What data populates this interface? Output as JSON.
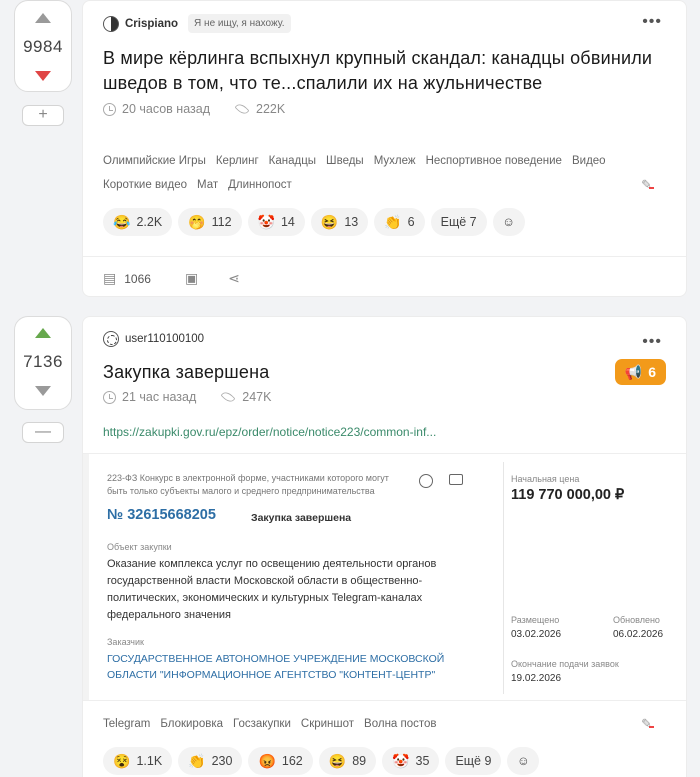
{
  "post1": {
    "rating": "9984",
    "author": "Crispiano",
    "status": "Я не ищу, я нахожу.",
    "title": "В мире кёрлинга вспыхнул крупный скандал: канадцы обвинили шведов в том, что те...спалили их на жульничестве",
    "time": "20 часов назад",
    "views": "222K",
    "tags": [
      "Олимпийские Игры",
      "Керлинг",
      "Канадцы",
      "Шведы",
      "Мухлеж",
      "Неспортивное поведение",
      "Видео",
      "Короткие видео",
      "Мат",
      "Длиннопост"
    ],
    "reactions": [
      {
        "emoji": "😂",
        "count": "2.2K"
      },
      {
        "emoji": "🤭",
        "count": "112"
      },
      {
        "emoji": "🤡",
        "count": "14"
      },
      {
        "emoji": "😆",
        "count": "13"
      },
      {
        "emoji": "👏",
        "count": "6"
      }
    ],
    "more_reactions": "Ещё 7",
    "comments": "1066",
    "rate_button": "+"
  },
  "post2": {
    "rating": "7136",
    "author": "user110100100",
    "title": "Закупка завершена",
    "badge": "6",
    "time": "21 час назад",
    "views": "247K",
    "link": "https://zakupki.gov.ru/epz/order/notice/notice223/common-inf...",
    "embed": {
      "law": "223-ФЗ Конкурс в электронной форме, участниками которого могут быть только субъекты малого и среднего предпринимательства",
      "number": "№ 32615668205",
      "status": "Закупка завершена",
      "object_label": "Объект закупки",
      "object_text": "Оказание комплекса услуг по освещению деятельности органов государственной власти Московской области в общественно-политических, экономических и культурных Telegram-каналах федерального значения",
      "customer_label": "Заказчик",
      "customer": "ГОСУДАРСТВЕННОЕ АВТОНОМНОЕ УЧРЕЖДЕНИЕ МОСКОВСКОЙ ОБЛАСТИ \"ИНФОРМАЦИОННОЕ АГЕНТСТВО \"КОНТЕНТ-ЦЕНТР\"",
      "price_label": "Начальная цена",
      "price": "119 770 000,00 ₽",
      "placed_label": "Размещено",
      "placed": "03.02.2026",
      "updated_label": "Обновлено",
      "updated": "06.02.2026",
      "deadline_label": "Окончание подачи заявок",
      "deadline": "19.02.2026"
    },
    "tags": [
      "Telegram",
      "Блокировка",
      "Госзакупки",
      "Скриншот",
      "Волна постов"
    ],
    "reactions": [
      {
        "emoji": "😵",
        "count": "1.1K"
      },
      {
        "emoji": "👏",
        "count": "230"
      },
      {
        "emoji": "😡",
        "count": "162"
      },
      {
        "emoji": "😆",
        "count": "89"
      },
      {
        "emoji": "🤡",
        "count": "35"
      }
    ],
    "more_reactions": "Ещё 9",
    "rate_button": "—"
  },
  "colors": {
    "upvote": "#67a84d",
    "downvote": "#e04545",
    "badge": "#f29a1a",
    "link": "#3a8a6a",
    "embed_link": "#2d6ea5"
  }
}
